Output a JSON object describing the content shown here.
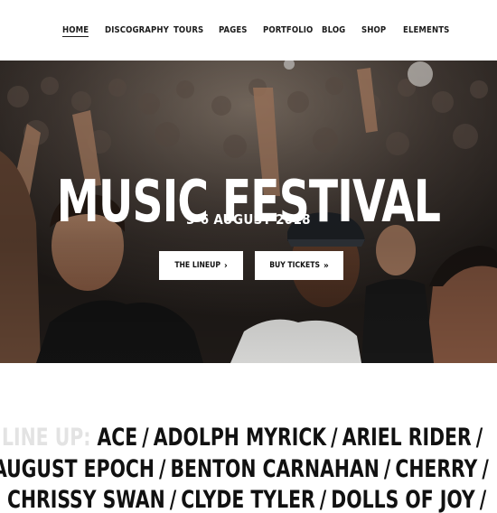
{
  "nav": {
    "items": [
      {
        "label": "HOME",
        "active": true
      },
      {
        "label": "DISCOGRAPHY",
        "active": false
      },
      {
        "label": "TOURS",
        "active": false
      },
      {
        "label": "PAGES",
        "active": false
      },
      {
        "label": "PORTFOLIO",
        "active": false
      },
      {
        "label": "BLOG",
        "active": false
      },
      {
        "label": "SHOP",
        "active": false
      },
      {
        "label": "ELEMENTS",
        "active": false
      }
    ]
  },
  "hero": {
    "title": "MUSIC FESTIVAL",
    "date": "3-6 AUGUST 2018",
    "buttons": [
      {
        "label": "THE LINEUP",
        "icon": "chevron-right-icon",
        "glyph": "›"
      },
      {
        "label": "BUY TICKETS",
        "icon": "double-chevron-right-icon",
        "glyph": "»"
      }
    ],
    "image_description": "concert crowd photo"
  },
  "lineup": {
    "label": "LINE UP:",
    "separator": "/",
    "row1": [
      "ACE",
      "ADOLPH MYRICK",
      "ARIEL RIDER"
    ],
    "row2": [
      "AUGUST EPOCH",
      "BENTON CARNAHAN",
      "CHERRY"
    ],
    "row3": [
      "CHRISSY SWAN",
      "CLYDE TYLER",
      "DOLLS OF JOY"
    ]
  },
  "colors": {
    "text": "#111111",
    "label_grey": "#e3e3e3",
    "hero_text": "#ffffff",
    "background": "#ffffff"
  }
}
